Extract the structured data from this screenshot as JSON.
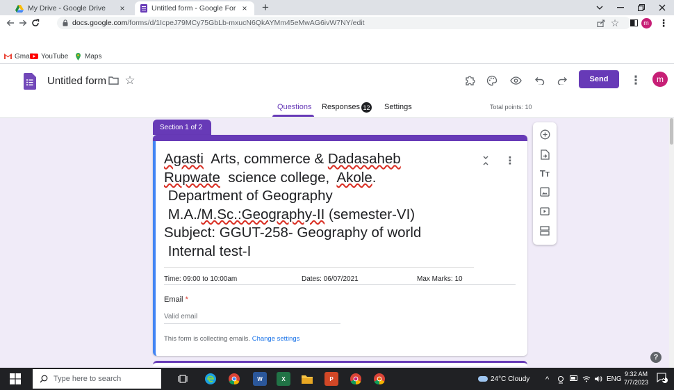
{
  "browser": {
    "tabs": [
      {
        "title": "My Drive - Google Drive",
        "close": "×"
      },
      {
        "title": "Untitled form - Google Forms",
        "close": "×"
      }
    ],
    "new_tab": "+",
    "url_host": "docs.google.com",
    "url_path": "/forms/d/1IcpeJ79MCy75GbLb-mxucN6QkAYMm45eMwAG6ivW7NY/edit",
    "profile_initial": "m",
    "bookmarks": [
      {
        "label": "Gmail",
        "icon": "gmail-icon"
      },
      {
        "label": "YouTube",
        "icon": "youtube-icon"
      },
      {
        "label": "Maps",
        "icon": "maps-icon"
      }
    ]
  },
  "forms": {
    "title": "Untitled form",
    "send_label": "Send",
    "avatar_initial": "m",
    "tabs": {
      "questions": "Questions",
      "responses": "Responses",
      "responses_count": "12",
      "settings": "Settings"
    },
    "total_points": "Total points: 10",
    "section_label": "Section 1 of 2",
    "description": {
      "line1_a": "Agasti",
      "line1_b": "  Arts, commerce & ",
      "line1_c": "Dadasaheb",
      "line2_a": "Rupwate",
      "line2_b": "  science college,  ",
      "line2_c": "Akole",
      "line2_d": ".",
      "line3": " Department of Geography",
      "line4_a": " M.A./",
      "line4_b": "M.Sc.:Geography-II",
      "line4_c": " (semester-VI)",
      "line5": "Subject: GGUT-258- Geography of world",
      "line6": " Internal test-I"
    },
    "meta": {
      "time": "Time: 09:00 to 10:00am",
      "dates": "Dates:  06/07/2021",
      "max_marks": "Max Marks: 10"
    },
    "email_label": "Email",
    "required_mark": "*",
    "email_placeholder": "Valid email",
    "email_note": "This form is collecting emails.",
    "change_settings": "Change settings",
    "help": "?"
  },
  "taskbar": {
    "search_placeholder": "Type here to search",
    "weather": "24°C  Cloudy",
    "language": "ENG",
    "time": "9:32 AM",
    "date": "7/7/2023",
    "notification_count": "2",
    "apps": [
      "task-view",
      "edge",
      "chrome-profile",
      "word",
      "excel",
      "file-explorer",
      "powerpoint",
      "chrome-red",
      "chrome-orange"
    ]
  },
  "colors": {
    "accent": "#673ab7",
    "page_bg": "#f0ebf8",
    "required": "#d93025",
    "link": "#1a73e8"
  }
}
